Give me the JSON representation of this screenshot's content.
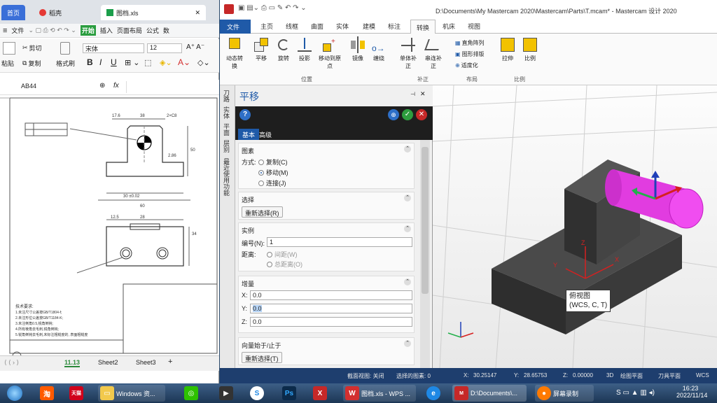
{
  "wps": {
    "tabs": [
      "首页",
      "稻壳",
      "图档.xls"
    ],
    "menu": [
      "文件",
      "开始",
      "插入",
      "页面布局",
      "公式",
      "数"
    ],
    "tools": {
      "cut": "剪切",
      "copy": "复制",
      "format_painter": "格式刷",
      "paste": "粘贴",
      "font": "宋体",
      "size": "12",
      "bold": "B",
      "italic": "I",
      "underline": "U"
    },
    "cell_ref": "AB44",
    "fx": "fx",
    "sheets": [
      "11.13",
      "Sheet2",
      "Sheet3"
    ],
    "add_sheet": "+",
    "drawing": {
      "dims": [
        "17.6",
        "38",
        "2×C8",
        "50",
        "60",
        "2.86",
        "30 ±0.02",
        "34",
        "12.5",
        "28"
      ],
      "notes": [
        "技术要求:",
        "1.未注尺寸公差按GB/T1804-f;",
        "2.未注形位公差按GB/T1184-K;",
        "3.未注倒角0.5,锐角倒钝;",
        "4.所有棱角去毛刺,锐角倒钝;",
        "5.锐角倒钝去毛刺,未标注粗糙度的, 表面粗糙度"
      ]
    }
  },
  "mc": {
    "title": "D:\\Documents\\My Mastercam 2020\\Mastercam\\Parts\\T.mcam* - Mastercam 设计 2020",
    "tabs": [
      "文件",
      "主页",
      "线框",
      "曲面",
      "实体",
      "建模",
      "标注",
      "转换",
      "机床",
      "视图"
    ],
    "active_tab": "转换",
    "ribbon": [
      "动态转换",
      "平移",
      "旋转",
      "投影",
      "移动到原点",
      "镜像",
      "缠绕",
      "单体补正",
      "串连补正",
      "直角阵列",
      "图形排版",
      "适度化",
      "拉伸",
      "比例"
    ],
    "groups": [
      "位置",
      "补正",
      "布局",
      "比例"
    ],
    "side_tabs": [
      "刀路",
      "实体",
      "平面",
      "层别",
      "最近使用功能"
    ],
    "panel": {
      "title": "平移",
      "tabs": [
        "基本",
        "高级"
      ],
      "sections": {
        "elements": "图素",
        "method_label": "方式:",
        "methods": [
          "复制(C)",
          "移动(M)",
          "连接(J)"
        ],
        "selected_method": "移动(M)",
        "select": "选择",
        "reselect": "重新选择(R)",
        "instance": "实例",
        "number_label": "编号(N):",
        "number_value": "1",
        "distance_label": "距离:",
        "distances": [
          "间距(W)",
          "总距离(O)"
        ],
        "delta": "增量",
        "x_label": "X:",
        "x_value": "0.0",
        "y_label": "Y:",
        "y_value": "0.0",
        "z_label": "Z:",
        "z_value": "0.0",
        "vector": "向量始于/止于",
        "reselect2": "重新选择(T)"
      }
    },
    "viewport": {
      "tooltip_line1": "俯视图",
      "tooltip_line2": "(WCS, C, T)"
    },
    "status": {
      "section_view": "截面视图: 关闭",
      "selected": "选择的图素: 0",
      "x_label": "X:",
      "x": "30.25147",
      "y_label": "Y:",
      "y": "28.65753",
      "z_label": "Z:",
      "z": "0.00000",
      "mode": "3D",
      "plane": "绘图平面",
      "tool_plane": "刀具平面",
      "wcs": "WCS"
    }
  },
  "taskbar": {
    "items": [
      "Windows 资...",
      "图档.xls - WPS ...",
      "D:\\Documents\\...",
      "屏幕录制"
    ],
    "time": "16:23",
    "date": "2022/11/14"
  }
}
